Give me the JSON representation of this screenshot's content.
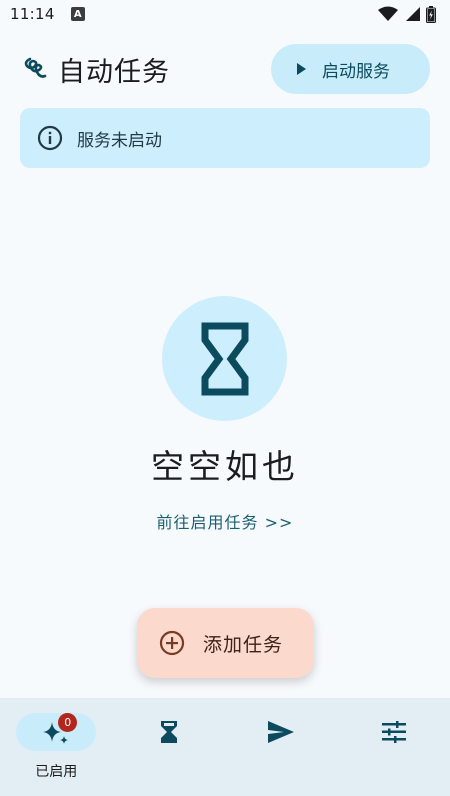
{
  "status_bar": {
    "time": "11:14",
    "notification_letter": "A"
  },
  "app": {
    "title": "自动任务"
  },
  "header": {
    "start_service_label": "启动服务"
  },
  "service_status": {
    "message": "服务未启动"
  },
  "empty_state": {
    "title": "空空如也",
    "link_label": "前往启用任务 >>"
  },
  "fab": {
    "label": "添加任务"
  },
  "bottom_nav": {
    "items": [
      {
        "label": "已启用",
        "icon": "sparkle-icon",
        "badge": "0",
        "active": true
      },
      {
        "label": "",
        "icon": "hourglass-icon",
        "active": false
      },
      {
        "label": "",
        "icon": "send-icon",
        "active": false
      },
      {
        "label": "",
        "icon": "tune-icon",
        "active": false
      }
    ]
  },
  "colors": {
    "accent": "#0c4a5e",
    "primary_container": "#c9ecfb",
    "fab_container": "#fbd9cd",
    "badge": "#b3261e",
    "nav_background": "#e3eef4"
  }
}
